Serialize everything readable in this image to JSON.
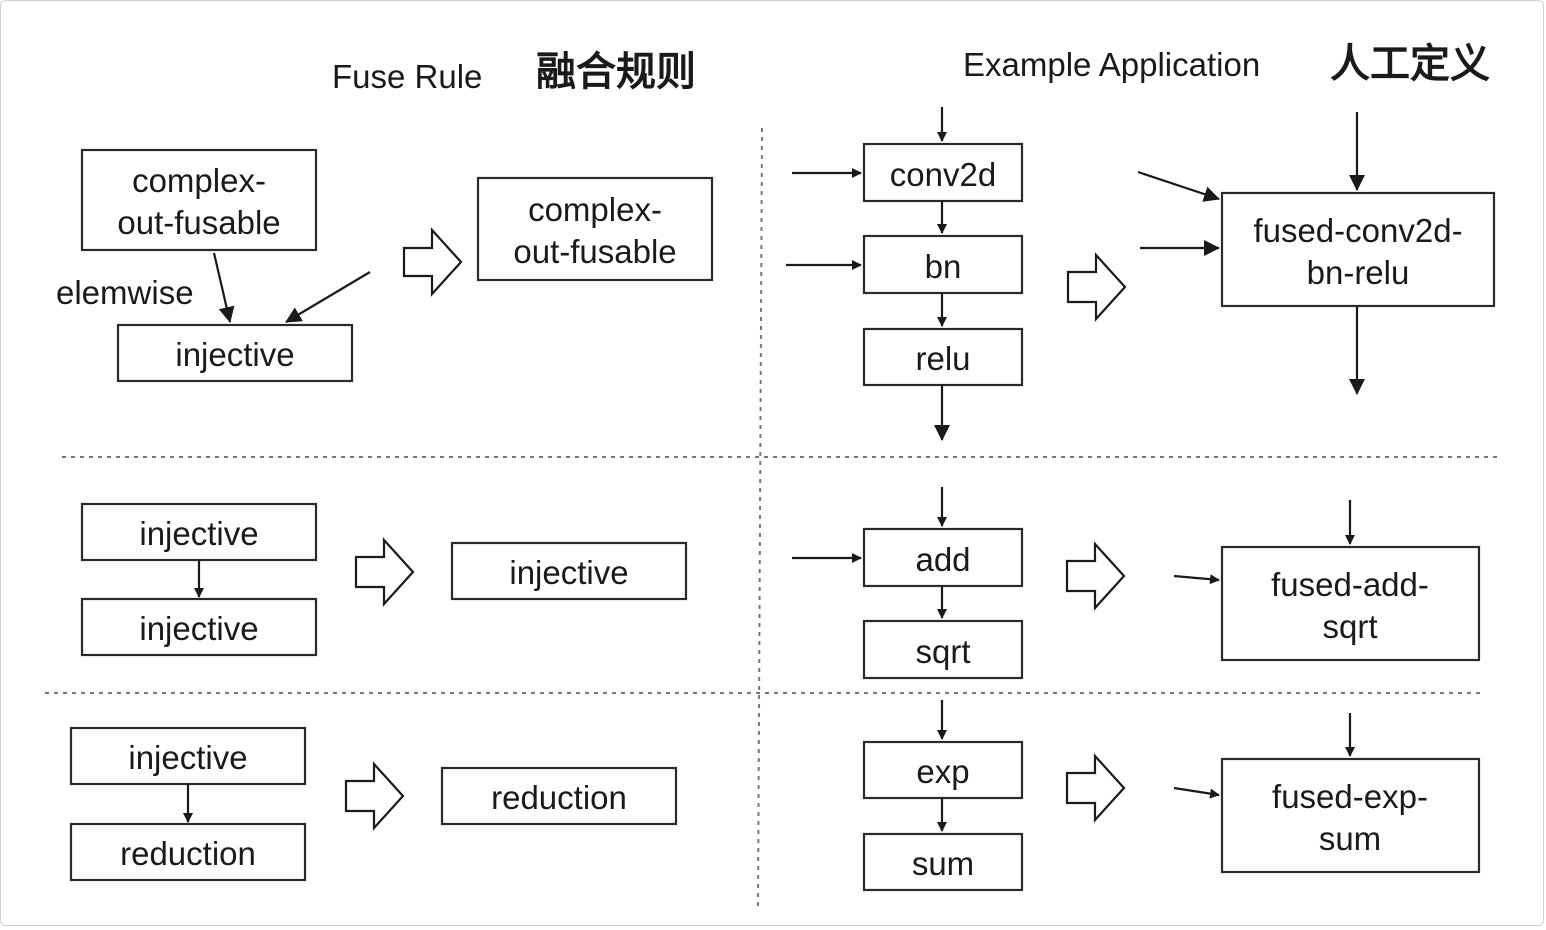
{
  "colors": {
    "accent_red": "#e5271b",
    "ink": "#1a1a1a"
  },
  "headings": {
    "fuse_rule": "Fuse Rule",
    "fuse_rule_cn": "融合规则",
    "example_application": "Example Application",
    "example_application_cn": "人工定义"
  },
  "rules": {
    "row1": {
      "source_top": [
        "complex-",
        "out-fusable"
      ],
      "edge_label": "elemwise",
      "source_bottom": "injective",
      "result": [
        "complex-",
        "out-fusable"
      ]
    },
    "row2": {
      "source_top": "injective",
      "source_bottom": "injective",
      "result": "injective"
    },
    "row3": {
      "source_top": "injective",
      "source_bottom": "reduction",
      "result": "reduction"
    }
  },
  "examples": {
    "row1": {
      "ops": [
        "conv2d",
        "bn",
        "relu"
      ],
      "fused": [
        "fused-conv2d-",
        "bn-relu"
      ]
    },
    "row2": {
      "ops": [
        "add",
        "sqrt"
      ],
      "fused": [
        "fused-add-",
        "sqrt"
      ]
    },
    "row3": {
      "ops": [
        "exp",
        "sum"
      ],
      "fused": [
        "fused-exp-",
        "sum"
      ]
    }
  }
}
